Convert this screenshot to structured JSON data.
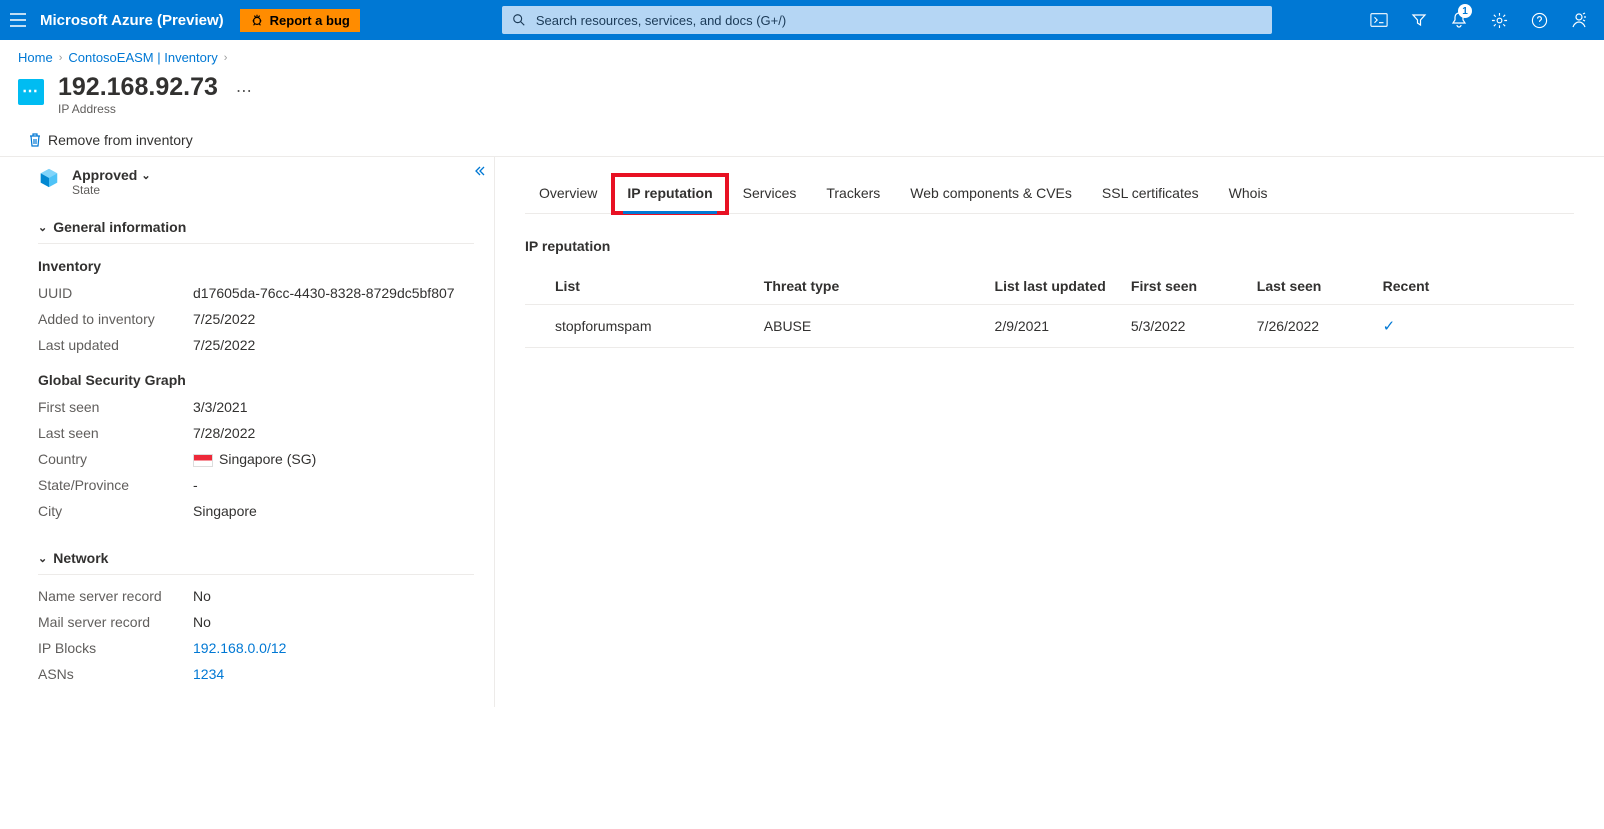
{
  "header": {
    "brand": "Microsoft Azure (Preview)",
    "bug_label": "Report a bug",
    "search_placeholder": "Search resources, services, and docs (G+/)",
    "notif_count": "1"
  },
  "breadcrumb": {
    "items": [
      "Home",
      "ContosoEASM | Inventory"
    ]
  },
  "page": {
    "title": "192.168.92.73",
    "subtitle": "IP Address"
  },
  "commands": {
    "remove": "Remove from inventory"
  },
  "state": {
    "value": "Approved",
    "label": "State"
  },
  "left": {
    "general_header": "General information",
    "inventory_header": "Inventory",
    "uuid_label": "UUID",
    "uuid_value": "d17605da-76cc-4430-8328-8729dc5bf807",
    "added_label": "Added to inventory",
    "added_value": "7/25/2022",
    "updated_label": "Last updated",
    "updated_value": "7/25/2022",
    "gsg_header": "Global Security Graph",
    "firstseen_label": "First seen",
    "firstseen_value": "3/3/2021",
    "lastseen_label": "Last seen",
    "lastseen_value": "7/28/2022",
    "country_label": "Country",
    "country_value": "Singapore (SG)",
    "province_label": "State/Province",
    "province_value": "-",
    "city_label": "City",
    "city_value": "Singapore",
    "network_header": "Network",
    "ns_label": "Name server record",
    "ns_value": "No",
    "mail_label": "Mail server record",
    "mail_value": "No",
    "ipblocks_label": "IP Blocks",
    "ipblocks_value": "192.168.0.0/12",
    "asns_label": "ASNs",
    "asns_value": "1234"
  },
  "tabs": {
    "overview": "Overview",
    "ip_reputation": "IP reputation",
    "services": "Services",
    "trackers": "Trackers",
    "webcomp": "Web components & CVEs",
    "ssl": "SSL certificates",
    "whois": "Whois"
  },
  "right": {
    "section_title": "IP reputation",
    "columns": {
      "list": "List",
      "threat": "Threat type",
      "updated": "List last updated",
      "first": "First seen",
      "last": "Last seen",
      "recent": "Recent"
    },
    "rows": [
      {
        "list": "stopforumspam",
        "threat": "ABUSE",
        "updated": "2/9/2021",
        "first": "5/3/2022",
        "last": "7/26/2022",
        "recent": "✓"
      }
    ]
  }
}
